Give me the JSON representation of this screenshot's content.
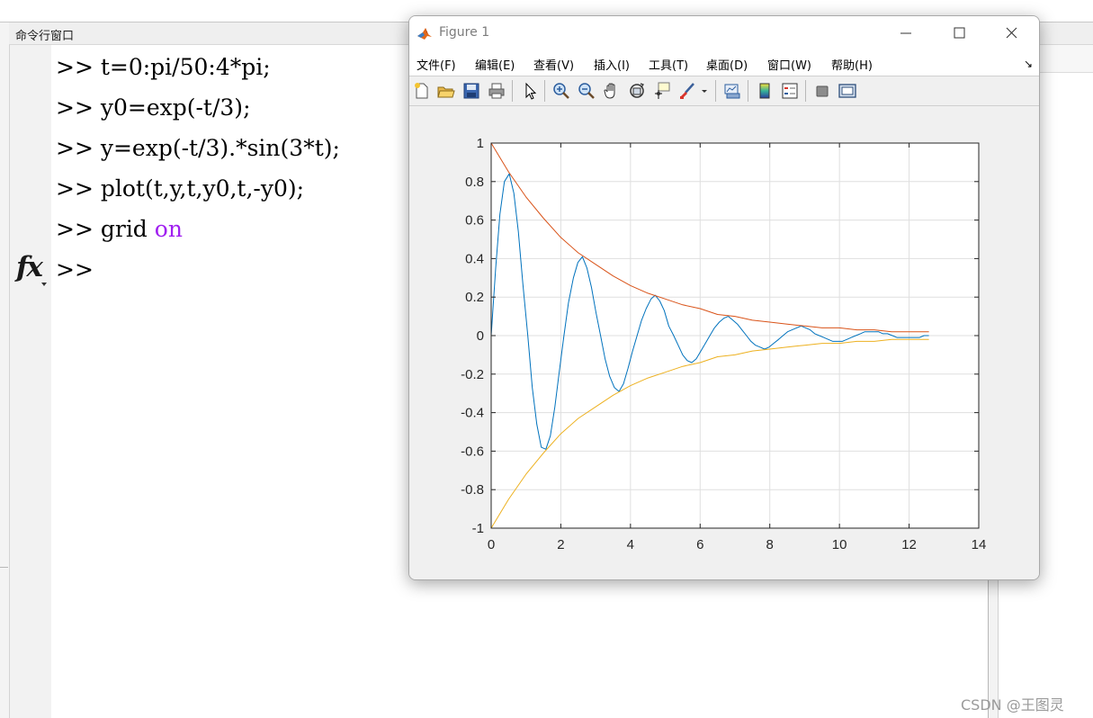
{
  "command_window": {
    "title": "命令行窗口",
    "prompt": ">>",
    "lines": [
      {
        "prompt": ">>",
        "code": "t=0:pi/50:4*pi;",
        "keyword": ""
      },
      {
        "prompt": ">>",
        "code": "y0=exp(-t/3);",
        "keyword": ""
      },
      {
        "prompt": ">>",
        "code": "y=exp(-t/3).*sin(3*t);",
        "keyword": ""
      },
      {
        "prompt": ">>",
        "code": "plot(t,y,t,y0,t,-y0);",
        "keyword": ""
      },
      {
        "prompt": ">>",
        "code": "grid ",
        "keyword": "on"
      },
      {
        "prompt": ">>",
        "code": "",
        "keyword": ""
      }
    ],
    "fx_icon": "fx-icon",
    "keyword_color": "#a020f0"
  },
  "figure": {
    "title": "Figure 1",
    "logo": "matlab-logo-icon",
    "controls": [
      "minimize-icon",
      "maximize-icon",
      "close-icon"
    ],
    "menu": [
      "文件(F)",
      "编辑(E)",
      "查看(V)",
      "插入(I)",
      "工具(T)",
      "桌面(D)",
      "窗口(W)",
      "帮助(H)"
    ],
    "menu_more": "↘",
    "toolbar": [
      "new-figure-icon",
      "open-file-icon",
      "save-icon",
      "print-icon",
      "edit-plot-cursor-icon",
      "zoom-in-icon",
      "zoom-out-icon",
      "pan-hand-icon",
      "rotate-3d-icon",
      "data-cursor-icon",
      "brush-icon",
      "brush-dropdown-icon",
      "link-plot-icon",
      "colorbar-icon",
      "legend-icon",
      "hide-plot-tools-icon",
      "show-plot-tools-icon"
    ]
  },
  "chart_data": {
    "type": "line",
    "title": "",
    "xlabel": "",
    "ylabel": "",
    "xlim": [
      0,
      14
    ],
    "ylim": [
      -1,
      1
    ],
    "xticks": [
      "0",
      "2",
      "4",
      "6",
      "8",
      "10",
      "12",
      "14"
    ],
    "yticks": [
      "1",
      "0.8",
      "0.6",
      "0.4",
      "0.2",
      "0",
      "-0.2",
      "-0.4",
      "-0.6",
      "-0.8",
      "-1"
    ],
    "grid": true,
    "series": [
      {
        "color": "#0072bd",
        "x": [
          0,
          0.13,
          0.25,
          0.38,
          0.52,
          0.65,
          0.78,
          0.91,
          1.05,
          1.18,
          1.31,
          1.44,
          1.57,
          1.7,
          1.83,
          1.96,
          2.09,
          2.22,
          2.36,
          2.49,
          2.62,
          2.75,
          2.88,
          3.01,
          3.14,
          3.27,
          3.4,
          3.54,
          3.67,
          3.8,
          3.93,
          4.06,
          4.19,
          4.32,
          4.45,
          4.59,
          4.71,
          4.84,
          4.97,
          5.1,
          5.24,
          5.37,
          5.5,
          5.63,
          5.76,
          5.89,
          6.02,
          6.15,
          6.28,
          6.41,
          6.55,
          6.68,
          6.81,
          6.94,
          7.07,
          7.2,
          7.33,
          7.46,
          7.59,
          7.72,
          7.85,
          7.98,
          8.11,
          8.25,
          8.38,
          8.51,
          8.64,
          8.77,
          8.9,
          9.03,
          9.16,
          9.29,
          9.42,
          9.55,
          9.68,
          9.81,
          9.94,
          10.08,
          10.21,
          10.34,
          10.47,
          10.6,
          10.73,
          10.86,
          10.99,
          11.12,
          11.25,
          11.38,
          11.52,
          11.65,
          11.78,
          11.91,
          12.04,
          12.17,
          12.3,
          12.43,
          12.57
        ],
        "y": [
          0,
          0.35,
          0.63,
          0.8,
          0.84,
          0.74,
          0.54,
          0.27,
          0,
          -0.27,
          -0.46,
          -0.58,
          -0.59,
          -0.52,
          -0.37,
          -0.18,
          0,
          0.17,
          0.3,
          0.38,
          0.41,
          0.35,
          0.25,
          0.12,
          0,
          -0.12,
          -0.21,
          -0.27,
          -0.29,
          -0.25,
          -0.17,
          -0.08,
          0,
          0.08,
          0.14,
          0.19,
          0.21,
          0.18,
          0.13,
          0.05,
          0,
          -0.05,
          -0.1,
          -0.13,
          -0.14,
          -0.12,
          -0.08,
          -0.04,
          0,
          0.04,
          0.07,
          0.09,
          0.1,
          0.08,
          0.06,
          0.03,
          0,
          -0.03,
          -0.05,
          -0.06,
          -0.07,
          -0.06,
          -0.04,
          -0.02,
          0,
          0.02,
          0.03,
          0.04,
          0.05,
          0.04,
          0.03,
          0.01,
          0,
          -0.01,
          -0.02,
          -0.03,
          -0.03,
          -0.03,
          -0.02,
          -0.01,
          0,
          0.01,
          0.02,
          0.02,
          0.02,
          0.02,
          0.01,
          0.01,
          0,
          -0.01,
          -0.01,
          -0.01,
          -0.01,
          -0.01,
          -0.01,
          0,
          0
        ]
      },
      {
        "color": "#d95319",
        "x": [
          0,
          0.5,
          1,
          1.5,
          2,
          2.5,
          3,
          3.5,
          4,
          4.5,
          5,
          5.5,
          6,
          6.5,
          7,
          7.5,
          8,
          8.5,
          9,
          9.5,
          10,
          10.5,
          11,
          11.5,
          12,
          12.57
        ],
        "y": [
          1,
          0.85,
          0.72,
          0.61,
          0.51,
          0.43,
          0.37,
          0.31,
          0.26,
          0.22,
          0.19,
          0.16,
          0.14,
          0.11,
          0.1,
          0.08,
          0.07,
          0.06,
          0.05,
          0.04,
          0.04,
          0.03,
          0.03,
          0.02,
          0.02,
          0.02
        ]
      },
      {
        "color": "#edb120",
        "x": [
          0,
          0.5,
          1,
          1.5,
          2,
          2.5,
          3,
          3.5,
          4,
          4.5,
          5,
          5.5,
          6,
          6.5,
          7,
          7.5,
          8,
          8.5,
          9,
          9.5,
          10,
          10.5,
          11,
          11.5,
          12,
          12.57
        ],
        "y": [
          -1,
          -0.85,
          -0.72,
          -0.61,
          -0.51,
          -0.43,
          -0.37,
          -0.31,
          -0.26,
          -0.22,
          -0.19,
          -0.16,
          -0.14,
          -0.11,
          -0.1,
          -0.08,
          -0.07,
          -0.06,
          -0.05,
          -0.04,
          -0.04,
          -0.03,
          -0.03,
          -0.02,
          -0.02,
          -0.02
        ]
      }
    ]
  },
  "watermark": "CSDN @王图灵"
}
